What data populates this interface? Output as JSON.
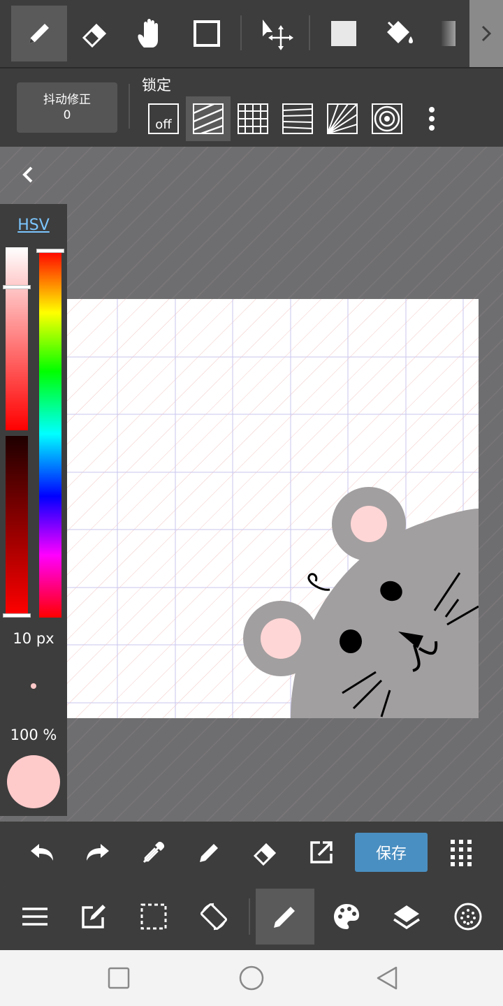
{
  "top_toolbar": {
    "tools": [
      {
        "name": "pen",
        "icon": "pen-icon",
        "active": true
      },
      {
        "name": "eraser",
        "icon": "eraser-icon"
      },
      {
        "name": "hand",
        "icon": "hand-icon"
      },
      {
        "name": "shape",
        "icon": "rectangle-icon"
      },
      {
        "name": "transform",
        "icon": "move-select-icon"
      },
      {
        "name": "fill-rect",
        "icon": "filled-square-icon"
      },
      {
        "name": "bucket",
        "icon": "paint-bucket-icon"
      },
      {
        "name": "gradient",
        "icon": "gradient-icon"
      }
    ],
    "more_icon": "chevron-right-icon"
  },
  "lock_bar": {
    "stabilizer_label": "抖动修正",
    "stabilizer_value": "0",
    "lock_label": "锁定",
    "rulers": [
      {
        "name": "off",
        "label": "off"
      },
      {
        "name": "parallel",
        "active": true
      },
      {
        "name": "grid"
      },
      {
        "name": "perspective"
      },
      {
        "name": "radial"
      },
      {
        "name": "concentric"
      }
    ],
    "more_icon": "vertical-dots-icon"
  },
  "color_panel": {
    "mode_label": "HSV",
    "brush_size": "10 px",
    "opacity": "100 %",
    "current_color": "#ffcaca"
  },
  "action_bar": {
    "save_label": "保存",
    "icons": [
      "undo-icon",
      "redo-icon",
      "eyedropper-icon",
      "pen-icon",
      "eraser-icon",
      "export-icon",
      "grid-menu-icon"
    ]
  },
  "nav_bar": {
    "icons": [
      "menu-icon",
      "edit-icon",
      "selection-icon",
      "rotate-icon",
      "brush-icon",
      "palette-icon",
      "layers-icon",
      "material-icon"
    ]
  },
  "colors": {
    "accent": "#4a8fc1",
    "toolbar": "#3d3d3d",
    "mouse_gray": "#a29fa0",
    "ear_pink": "#ffd6d6"
  }
}
